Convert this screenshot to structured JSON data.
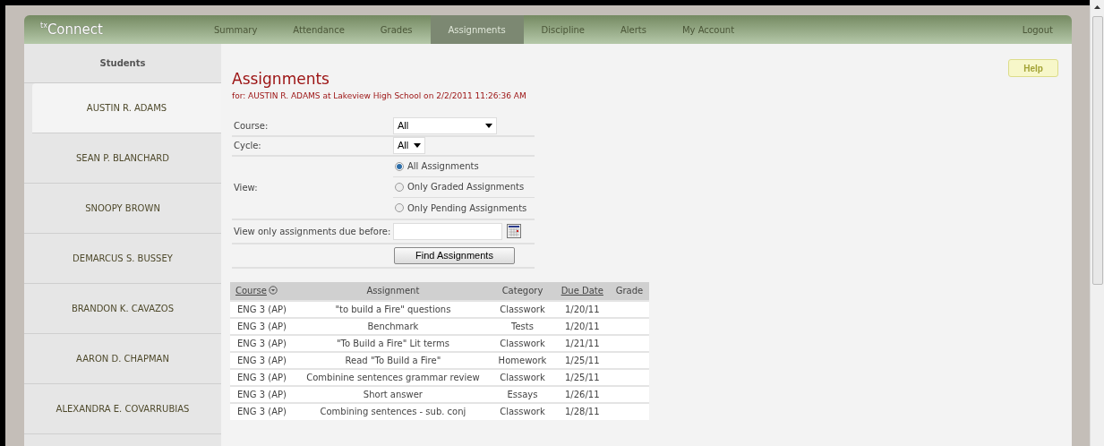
{
  "header": {
    "logo_prefix": "tx",
    "logo": "Connect",
    "nav": [
      {
        "label": "Summary",
        "selected": false
      },
      {
        "label": "Attendance",
        "selected": false
      },
      {
        "label": "Grades",
        "selected": false
      },
      {
        "label": "Assignments",
        "selected": true
      },
      {
        "label": "Discipline",
        "selected": false
      },
      {
        "label": "Alerts",
        "selected": false
      },
      {
        "label": "My Account",
        "selected": false
      }
    ],
    "logout": "Logout"
  },
  "sidebar": {
    "title": "Students",
    "items": [
      {
        "label": "AUSTIN R. ADAMS",
        "selected": true
      },
      {
        "label": "SEAN P. BLANCHARD",
        "selected": false
      },
      {
        "label": "SNOOPY BROWN",
        "selected": false
      },
      {
        "label": "DEMARCUS S. BUSSEY",
        "selected": false
      },
      {
        "label": "BRANDON K. CAVAZOS",
        "selected": false
      },
      {
        "label": "AARON D. CHAPMAN",
        "selected": false
      },
      {
        "label": "ALEXANDRA E. COVARRUBIAS",
        "selected": false
      }
    ]
  },
  "page": {
    "title": "Assignments",
    "subtitle": "for: AUSTIN R. ADAMS at Lakeview High School on 2/2/2011 11:26:36 AM",
    "help": "Help"
  },
  "form": {
    "course": {
      "label": "Course:",
      "value": "All"
    },
    "cycle": {
      "label": "Cycle:",
      "value": "All"
    },
    "view": {
      "label": "View:",
      "options": [
        {
          "label": "All Assignments",
          "selected": true
        },
        {
          "label": "Only Graded Assignments",
          "selected": false
        },
        {
          "label": "Only Pending Assignments",
          "selected": false
        }
      ]
    },
    "due_before": {
      "label": "View only assignments due before:"
    },
    "submit": "Find Assignments"
  },
  "table": {
    "columns": [
      {
        "label": "Course",
        "sortable": true,
        "sorted": true
      },
      {
        "label": "Assignment",
        "sortable": false,
        "sorted": false
      },
      {
        "label": "Category",
        "sortable": false,
        "sorted": false
      },
      {
        "label": "Due Date",
        "sortable": true,
        "sorted": false
      },
      {
        "label": "Grade",
        "sortable": false,
        "sorted": false
      }
    ],
    "rows": [
      [
        "ENG 3 (AP)",
        "\"to build a Fire\" questions",
        "Classwork",
        "1/20/11"
      ],
      [
        "ENG 3 (AP)",
        "Benchmark",
        "Tests",
        "1/20/11"
      ],
      [
        "ENG 3 (AP)",
        "\"To Build a Fire\" Lit terms",
        "Classwork",
        "1/21/11"
      ],
      [
        "ENG 3 (AP)",
        "Read \"To Build a Fire\"",
        "Homework",
        "1/25/11"
      ],
      [
        "ENG 3 (AP)",
        "Combinine sentences grammar review",
        "Classwork",
        "1/25/11"
      ],
      [
        "ENG 3 (AP)",
        "Short answer",
        "Essays",
        "1/26/11"
      ],
      [
        "ENG 3 (AP)",
        "Combining sentences - sub. conj",
        "Classwork",
        "1/28/11"
      ]
    ]
  }
}
